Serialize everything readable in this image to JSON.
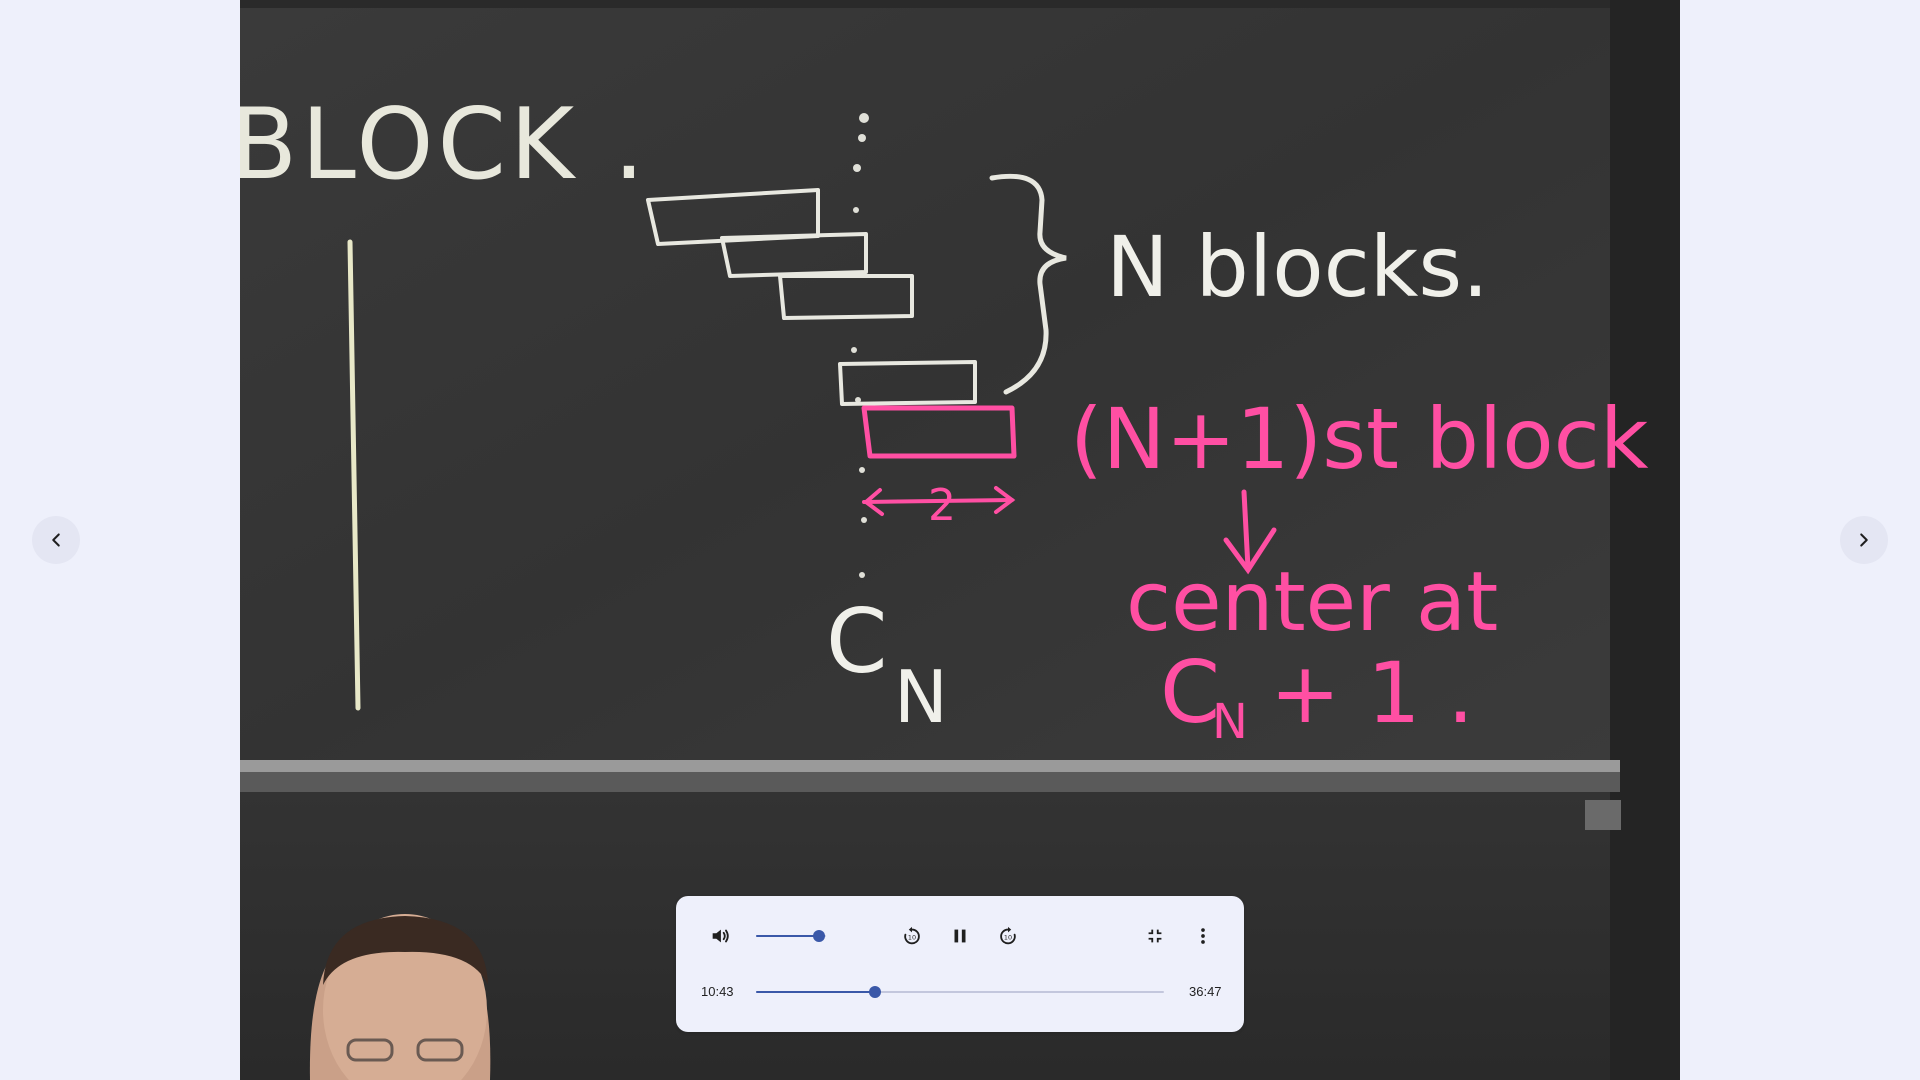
{
  "navigation": {
    "previous_icon": "chevron-left-icon",
    "next_icon": "chevron-right-icon"
  },
  "video": {
    "board_text": {
      "title": "BLOCK .",
      "n_blocks": "N blocks.",
      "n_plus_one": "(N+1)st block",
      "arrow_label": "2",
      "center_at": "center at",
      "cn": "C",
      "cn_sub": "N",
      "cn_plus_one": "C",
      "cn_plus_one_sub": "N",
      "cn_plus_one_rest": "+ 1 ."
    }
  },
  "player": {
    "current_time": "10:43",
    "total_time": "36:47",
    "progress_fraction": 0.291,
    "volume_fraction": 0.9,
    "icons": {
      "volume": "volume-up-icon",
      "replay": "replay-10-icon",
      "pause": "pause-icon",
      "forward": "forward-10-icon",
      "exit_fullscreen": "fullscreen-exit-icon",
      "more": "more-vert-icon"
    },
    "colors": {
      "accent": "#3a58a8",
      "panel": "#eef0fb"
    }
  }
}
